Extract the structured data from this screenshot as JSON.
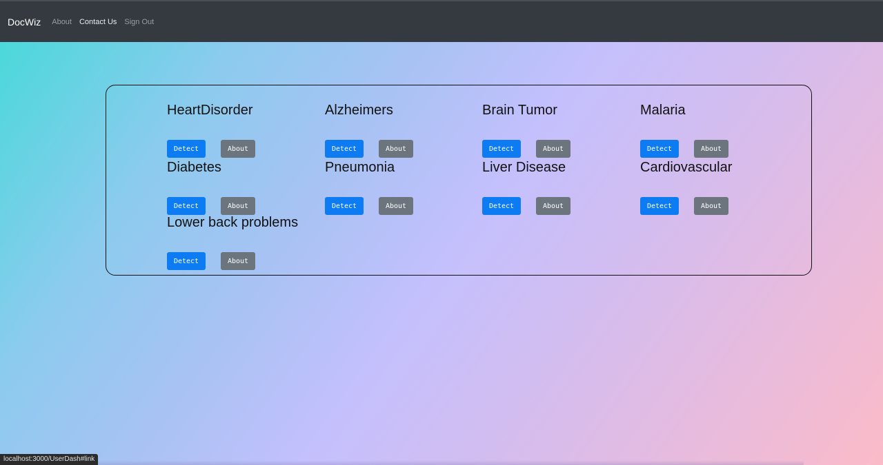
{
  "nav": {
    "brand": "DocWiz",
    "links": [
      "About",
      "Contact Us",
      "Sign Out"
    ]
  },
  "cards": [
    {
      "title": "HeartDisorder",
      "detect": "Detect",
      "about": "About"
    },
    {
      "title": "Alzheimers",
      "detect": "Detect",
      "about": "About"
    },
    {
      "title": "Brain Tumor",
      "detect": "Detect",
      "about": "About"
    },
    {
      "title": "Malaria",
      "detect": "Detect",
      "about": "About"
    },
    {
      "title": "Diabetes",
      "detect": "Detect",
      "about": "About"
    },
    {
      "title": "Pneumonia",
      "detect": "Detect",
      "about": "About"
    },
    {
      "title": "Liver Disease",
      "detect": "Detect",
      "about": "About"
    },
    {
      "title": "Cardiovascular",
      "detect": "Detect",
      "about": "About"
    },
    {
      "title": "Lower back problems",
      "detect": "Detect",
      "about": "About"
    }
  ],
  "status": {
    "url": "localhost:3000/UserDash#link"
  },
  "colors": {
    "navbar": "#343a40",
    "detect_button": "#0d7cf2",
    "about_button": "#6c757d"
  }
}
